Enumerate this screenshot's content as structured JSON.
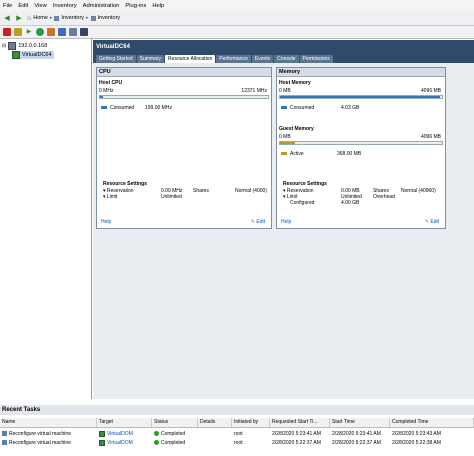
{
  "menu": [
    "File",
    "Edit",
    "View",
    "Inventory",
    "Administration",
    "Plug-ins",
    "Help"
  ],
  "nav": {
    "home": "Home",
    "inventory1": "Inventory",
    "inventory2": "Inventory"
  },
  "tree": {
    "host": "192.0.0.168",
    "vm": "VirtualDC64"
  },
  "vm_title": "VirtualDC64",
  "tabs": [
    "Getting Started",
    "Summary",
    "Resource Allocation",
    "Performance",
    "Events",
    "Console",
    "Permissions"
  ],
  "active_tab": "Resource Allocation",
  "cpu": {
    "header": "CPU",
    "section": "Host CPU",
    "min": "0 MHz",
    "max": "12371 MHz",
    "consumed_label": "Consumed",
    "consumed_value": "199.00 MHz",
    "consumed_fraction": 0.016,
    "settings_title": "Resource Settings",
    "reservation_label": "Reservation",
    "reservation_value": "0.00 MHz",
    "limit_label": "Limit",
    "limit_value": "Unlimited",
    "shares_label": "Shares",
    "shares_value": "Normal (4000)",
    "help": "Help",
    "edit": "Edit"
  },
  "memory": {
    "header": "Memory",
    "host_section": "Host Memory",
    "host_min": "0 MB",
    "host_max": "4096 MB",
    "consumed_label": "Consumed",
    "consumed_value": "4.03 GB",
    "consumed_fraction": 0.99,
    "guest_section": "Guest Memory",
    "guest_min": "0 MB",
    "guest_max": "4096 MB",
    "active_label": "Active",
    "active_value": "368.00 MB",
    "active_fraction": 0.09,
    "settings_title": "Resource Settings",
    "reservation_label": "Reservation",
    "reservation_value": "0.00 MB",
    "limit_label": "Limit",
    "limit_value": "Unlimited",
    "configured_label": "Configured",
    "configured_value": "4.00 GB",
    "shares_label": "Shares",
    "shares_value": "Normal (40960)",
    "overhead_label": "Overhead",
    "overhead_value": "",
    "overhead_display": "",
    "help": "Help",
    "edit": "Edit"
  },
  "tasks": {
    "title": "Recent Tasks",
    "columns": [
      "Name",
      "Target",
      "Status",
      "Details",
      "Initiated by",
      "Requested Start Ti...",
      "Start Time",
      "Completed Time"
    ],
    "rows": [
      {
        "name": "Reconfigure virtual machine",
        "target": "VirtualDOM",
        "status": "Completed",
        "details": "",
        "initiated": "root",
        "requested": "2/28/2020 5:23:41 AM",
        "start": "2/28/2020 5:23:41 AM",
        "completed": "2/28/2020 5:23:43 AM"
      },
      {
        "name": "Reconfigure virtual machine",
        "target": "VirtualDOM",
        "status": "Completed",
        "details": "",
        "initiated": "root",
        "requested": "2/28/2020 5:22:37 AM",
        "start": "2/28/2020 5:22:37 AM",
        "completed": "2/28/2020 5:22:38 AM"
      }
    ]
  },
  "colors": {
    "title_bar": "#2f4a6b",
    "accent_blue": "#2d77c6",
    "guest_mem": "#b59b2a",
    "ok": "#2c9a2c"
  }
}
